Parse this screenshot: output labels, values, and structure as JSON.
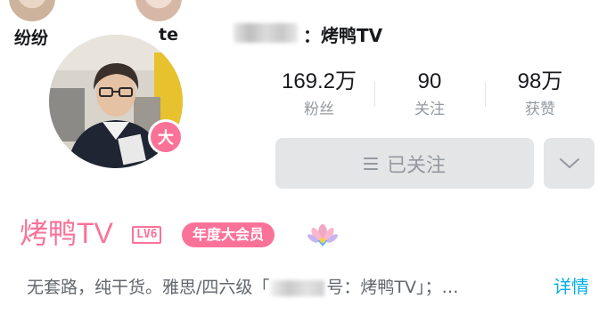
{
  "top_bar": {
    "users": [
      {
        "name": "纷纷"
      },
      {
        "name": "te"
      }
    ],
    "channel_line": "：烤鸭TV"
  },
  "profile": {
    "avatar_badge": "大",
    "stats": [
      {
        "value": "169.2万",
        "label": "粉丝"
      },
      {
        "value": "90",
        "label": "关注"
      },
      {
        "value": "98万",
        "label": "获赞"
      }
    ],
    "follow_label": "已关注",
    "name": "烤鸭TV",
    "level": "LV6",
    "vip_label": "年度大会员",
    "bio_prefix": "无套路，纯干货。雅思/四六级「",
    "bio_suffix": "号：烤鸭TV」；…",
    "details_label": "详情"
  },
  "colors": {
    "accent_pink": "#fb7299",
    "link_blue": "#00aeec",
    "muted_text": "#9499a0",
    "button_bg": "#e3e5e7"
  },
  "icons": {
    "follow_icon": "menu-lines-icon",
    "dropdown_icon": "chevron-down-icon",
    "vip_icon": "lotus-icon"
  }
}
